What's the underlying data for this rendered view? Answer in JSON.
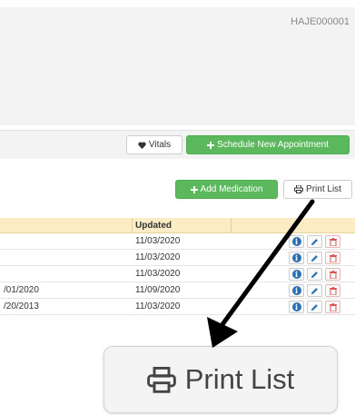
{
  "header": {
    "patient_id": "HAJE000001"
  },
  "toolbar": {
    "vitals_label": "Vitals",
    "schedule_label": "Schedule New Appointment"
  },
  "medications": {
    "add_label": "Add Medication",
    "print_label": "Print List",
    "columns": [
      "Updated"
    ],
    "rows": [
      {
        "col1": "",
        "updated": "11/03/2020"
      },
      {
        "col1": "",
        "updated": "11/03/2020"
      },
      {
        "col1": "",
        "updated": "11/03/2020"
      },
      {
        "col1": "/01/2020",
        "updated": "11/09/2020"
      },
      {
        "col1": "/20/2013",
        "updated": "11/03/2020"
      }
    ]
  },
  "zoom": {
    "print_label": "Print List"
  },
  "icons": {
    "vitals": "heart-icon",
    "schedule": "plus-icon",
    "add": "plus-icon",
    "print": "printer-icon",
    "info": "info-icon",
    "edit": "pencil-icon",
    "delete": "trash-icon"
  },
  "colors": {
    "green": "#5cb85c",
    "header_bg": "#fbecc6",
    "info_blue": "#2a6fb3",
    "delete_red": "#d9534f"
  }
}
